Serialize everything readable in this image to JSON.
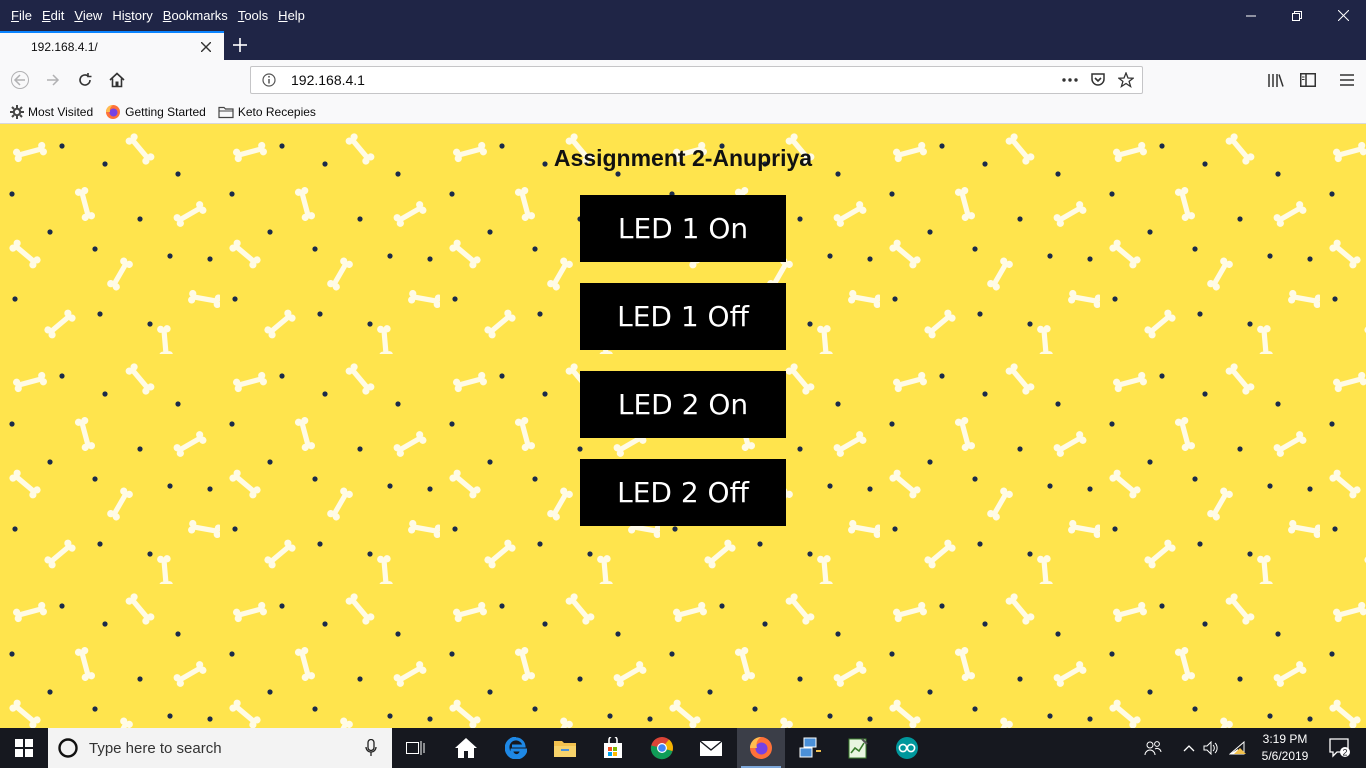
{
  "menubar": {
    "items": [
      {
        "pre": "",
        "u": "F",
        "post": "ile"
      },
      {
        "pre": "",
        "u": "E",
        "post": "dit"
      },
      {
        "pre": "",
        "u": "V",
        "post": "iew"
      },
      {
        "pre": "Hi",
        "u": "s",
        "post": "tory"
      },
      {
        "pre": "",
        "u": "B",
        "post": "ookmarks"
      },
      {
        "pre": "",
        "u": "T",
        "post": "ools"
      },
      {
        "pre": "",
        "u": "H",
        "post": "elp"
      }
    ]
  },
  "tab": {
    "title": "192.168.4.1/"
  },
  "urlbar": {
    "url": "192.168.4.1"
  },
  "bookmarks": [
    {
      "label": "Most Visited",
      "icon": "gear-icon"
    },
    {
      "label": "Getting Started",
      "icon": "firefox-icon"
    },
    {
      "label": "Keto Recepies",
      "icon": "folder-icon"
    }
  ],
  "page": {
    "title": "Assignment 2-Anupriya",
    "buttons": [
      "LED 1 On",
      "LED 1 Off",
      "LED 2 On",
      "LED 2 Off"
    ]
  },
  "taskbar": {
    "search_placeholder": "Type here to search",
    "time": "3:19 PM",
    "date": "5/6/2019",
    "notifications": "2"
  },
  "colors": {
    "page_background": "#ffe44d",
    "button_background": "#000000",
    "chrome_dark": "#1f2546",
    "accent": "#0a84ff"
  }
}
